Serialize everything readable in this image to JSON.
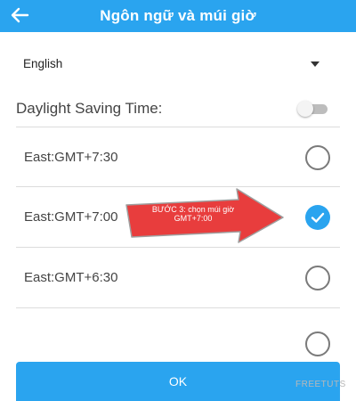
{
  "header": {
    "title": "Ngôn ngữ và múi giờ",
    "back_icon": "arrow-left-icon",
    "background": "#2aa4ef"
  },
  "language": {
    "selected": "English",
    "dropdown_icon": "caret-down-icon"
  },
  "dst": {
    "label": "Daylight Saving Time:",
    "enabled": false
  },
  "timezones": [
    {
      "label": "East:GMT+7:30",
      "selected": false
    },
    {
      "label": "East:GMT+7:00",
      "selected": true
    },
    {
      "label": "East:GMT+6:30",
      "selected": false
    }
  ],
  "callout": {
    "text_line1": "BƯỚC 3: chọn múi giờ",
    "text_line2": "GMT+7:00",
    "color": "#e83d3d"
  },
  "ok_button": {
    "label": "OK"
  },
  "watermark": {
    "text": "FREETUTS"
  },
  "colors": {
    "accent": "#2aa4ef",
    "text": "#444444"
  }
}
